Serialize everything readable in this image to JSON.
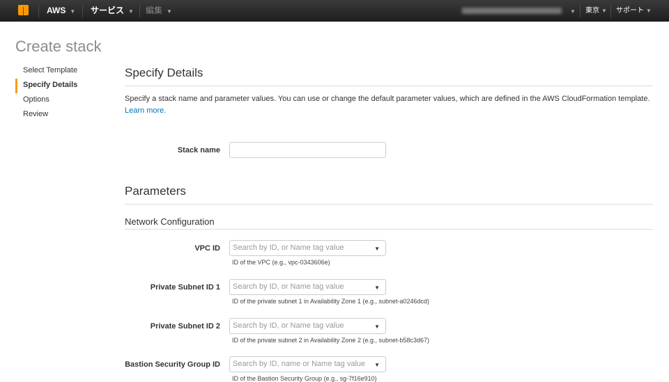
{
  "topbar": {
    "aws": "AWS",
    "services": "サービス",
    "edit": "編集",
    "region": "東京",
    "support": "サポート"
  },
  "page_title": "Create stack",
  "nav": [
    "Select Template",
    "Specify Details",
    "Options",
    "Review"
  ],
  "details": {
    "title": "Specify Details",
    "description": "Specify a stack name and parameter values. You can use or change the default parameter values, which are defined in the AWS CloudFormation template.",
    "learn_more": "Learn more.",
    "stack_name_label": "Stack name",
    "stack_name_value": ""
  },
  "parameters": {
    "title": "Parameters",
    "section": "Network Configuration",
    "fields": [
      {
        "label": "VPC ID",
        "placeholder": "Search by ID, or Name tag value",
        "help": "ID of the VPC (e.g., vpc-0343606e)"
      },
      {
        "label": "Private Subnet ID 1",
        "placeholder": "Search by ID, or Name tag value",
        "help": "ID of the private subnet 1 in Availability Zone 1 (e.g., subnet-a0246dcd)"
      },
      {
        "label": "Private Subnet ID 2",
        "placeholder": "Search by ID, or Name tag value",
        "help": "ID of the private subnet 2 in Availability Zone 2 (e.g., subnet-b58c3d67)"
      },
      {
        "label": "Bastion Security Group ID",
        "placeholder": "Search by ID, name or Name tag value",
        "help": "ID of the Bastion Security Group (e.g., sg-7f16e910)"
      }
    ]
  }
}
